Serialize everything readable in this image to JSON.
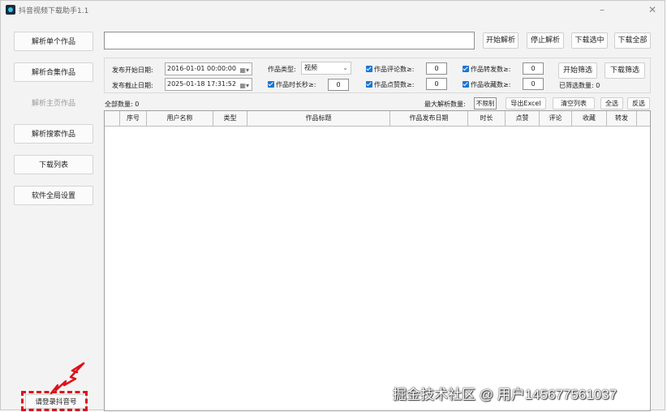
{
  "window": {
    "title": "抖音视频下载助手1.1"
  },
  "sidebar": {
    "items": [
      {
        "label": "解析单个作品"
      },
      {
        "label": "解析合集作品"
      },
      {
        "label": "解析主页作品"
      },
      {
        "label": "解析搜索作品"
      },
      {
        "label": "下载列表"
      },
      {
        "label": "软件全局设置"
      }
    ],
    "login_label": "请登录抖音号"
  },
  "toolbar": {
    "url_value": "",
    "start_parse": "开始解析",
    "stop_parse": "停止解析",
    "download_selected": "下载选中",
    "download_all": "下载全部"
  },
  "filters": {
    "start_date_label": "发布开始日期:",
    "start_date_value": "2016-01-01 00:00:00",
    "end_date_label": "发布截止日期:",
    "end_date_value": "2025-01-18 17:31:52",
    "type_label": "作品类型:",
    "type_value": "视频",
    "duration_label": "作品时长秒≥:",
    "duration_value": "0",
    "comments_label": "作品评论数≥:",
    "comments_value": "0",
    "likes_label": "作品点赞数≥:",
    "likes_value": "0",
    "shares_label": "作品转发数≥:",
    "shares_value": "0",
    "favorites_label": "作品收藏数≥:",
    "favorites_value": "0",
    "start_filter": "开始筛选",
    "download_filter": "下载筛选",
    "filtered_count": "已筛选数量: 0"
  },
  "list_bar": {
    "total": "全部数量: 0",
    "max_parse_label": "最大解析数量:",
    "max_parse_value": "不限制",
    "export_excel": "导出Excel",
    "clear_list": "清空列表",
    "select_all": "全选",
    "invert": "反选"
  },
  "table": {
    "columns": [
      "序号",
      "用户名称",
      "类型",
      "作品标题",
      "作品发布日期",
      "时长",
      "点赞",
      "评论",
      "收藏",
      "转发"
    ]
  },
  "watermark": "掘金技术社区 @ 用户145677561037",
  "colors": {
    "accent_check": "#1976d2",
    "highlight": "#e0101a"
  }
}
